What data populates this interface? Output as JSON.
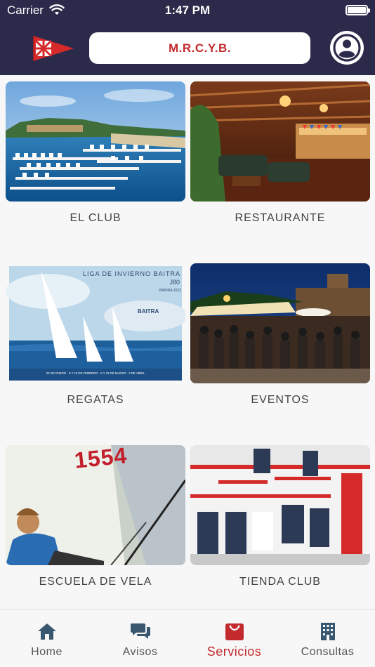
{
  "status_bar": {
    "carrier": "Carrier",
    "time": "1:47 PM"
  },
  "header": {
    "title": "M.R.C.Y.B.",
    "flag_icon": "club-burgee-icon",
    "profile_icon": "user-profile-icon"
  },
  "colors": {
    "header_bg": "#2c2a4a",
    "accent": "#c22a2e",
    "tab_inactive": "#555555"
  },
  "menu": [
    {
      "label": "EL CLUB",
      "image": "marina-harbor-photo"
    },
    {
      "label": "RESTAURANTE",
      "image": "restaurant-bar-interior-photo"
    },
    {
      "label": "REGATAS",
      "image": "regatta-poster-image"
    },
    {
      "label": "EVENTOS",
      "image": "evening-event-crowd-photo"
    },
    {
      "label": "ESCUELA DE VELA",
      "image": "sailing-school-photo"
    },
    {
      "label": "TIENDA CLUB",
      "image": "club-shop-photo"
    }
  ],
  "regatta_poster": {
    "title": "LIGA DE INVIERNO BAITRA",
    "subtitle": "J80",
    "season": "BAIONA 2022",
    "sponsor": "BAITRA",
    "dates": "22 DE ENERO · 5 Y 19 DE FEBRERO · 5 Y 19 DE MARZO · 2 DE ABRIL"
  },
  "sail_number": "1554",
  "tabs": [
    {
      "label": "Home",
      "icon": "home-icon",
      "active": false
    },
    {
      "label": "Avisos",
      "icon": "chat-bubbles-icon",
      "active": false
    },
    {
      "label": "Servicios",
      "icon": "shopping-bag-icon",
      "active": true
    },
    {
      "label": "Consultas",
      "icon": "building-icon",
      "active": false
    }
  ]
}
